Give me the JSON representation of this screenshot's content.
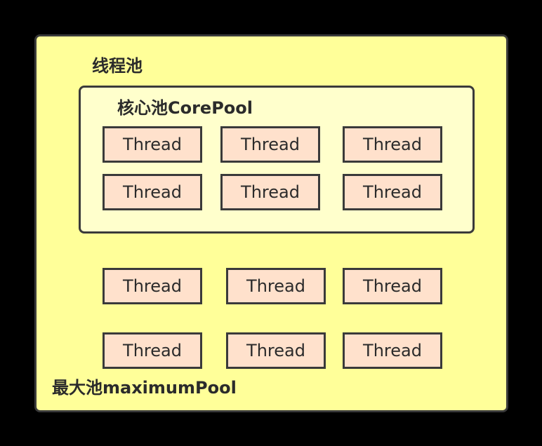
{
  "diagram": {
    "pool_label": "线程池",
    "core_pool_label": "核心池CorePool",
    "max_pool_label": "最大池maximumPool",
    "thread_label": "Thread",
    "colors": {
      "background": "#000000",
      "outer_pool_fill": "#ffff99",
      "core_pool_fill": "#ffffcc",
      "thread_fill": "#ffe1cc",
      "border": "#3a3a3a",
      "text": "#2b2b2b"
    },
    "core_threads": [
      {
        "label": "Thread"
      },
      {
        "label": "Thread"
      },
      {
        "label": "Thread"
      },
      {
        "label": "Thread"
      },
      {
        "label": "Thread"
      },
      {
        "label": "Thread"
      }
    ],
    "extra_threads": [
      {
        "label": "Thread"
      },
      {
        "label": "Thread"
      },
      {
        "label": "Thread"
      },
      {
        "label": "Thread"
      },
      {
        "label": "Thread"
      },
      {
        "label": "Thread"
      }
    ]
  }
}
